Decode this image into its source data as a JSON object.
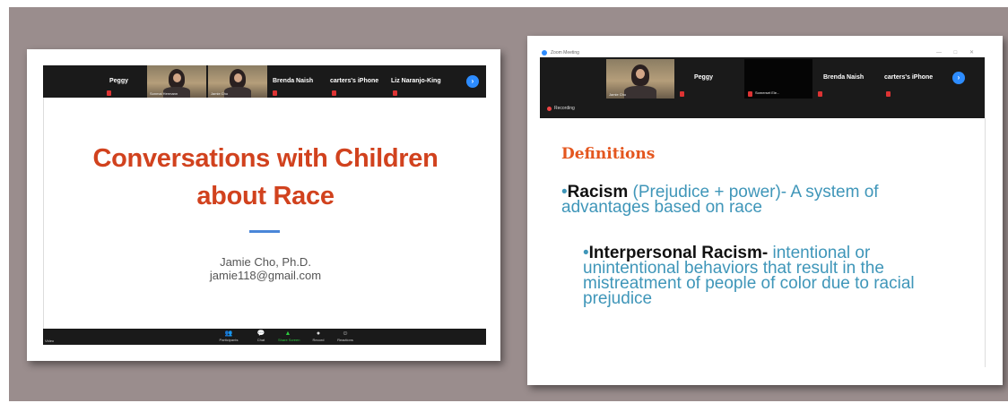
{
  "left": {
    "participants": [
      {
        "name": "Peggy"
      },
      {
        "name": "",
        "caption": "Sonmai Hermann"
      },
      {
        "name": "",
        "caption": "Jamie Cho"
      },
      {
        "name": "Brenda Naish"
      },
      {
        "name": "carters's iPhone"
      },
      {
        "name": "Liz Naranjo-King"
      }
    ],
    "next_arrow": "›",
    "slide": {
      "title_line1": "Conversations with Children",
      "title_line2": "about Race",
      "author": "Jamie Cho, Ph.D.",
      "email": "jamie118@gmail.com"
    },
    "controls": [
      {
        "label": "Participants",
        "icon": "👥"
      },
      {
        "label": "Chat",
        "icon": "💬"
      },
      {
        "label": "Share Screen",
        "icon": "▲"
      },
      {
        "label": "Record",
        "icon": "●"
      },
      {
        "label": "Reactions",
        "icon": "☺"
      }
    ],
    "left_ctrl_label": "Video"
  },
  "right": {
    "app_title": "Zoom Meeting",
    "window_buttons": "— □ ✕",
    "participants": [
      {
        "name": "",
        "caption": "Jamie Cho"
      },
      {
        "name": "Peggy"
      },
      {
        "name": "",
        "caption": "Somerset Ele..."
      },
      {
        "name": "Brenda Naish"
      },
      {
        "name": "carters's iPhone"
      }
    ],
    "next_arrow": "›",
    "recording_label": "Recording",
    "slide": {
      "heading": "Definitions",
      "item1_term": "Racism",
      "item1_rest_line1": " (Prejudice + power)- A system of",
      "item1_line2": "advantages based on race",
      "item2_term": "Interpersonal Racism",
      "item2_dash": "- ",
      "item2_rest_line1": "intentional or",
      "item2_line2": "unintentional behaviors that result in the",
      "item2_line3": "mistreatment of people of color due to racial",
      "item2_line4": "prejudice",
      "bullet": "•"
    }
  },
  "colors": {
    "background": "#9a8d8d",
    "title_red": "#d1421e",
    "definitions_orange": "#e4561e",
    "definition_teal": "#3f96b9",
    "zoom_blue": "#2d8cff"
  }
}
